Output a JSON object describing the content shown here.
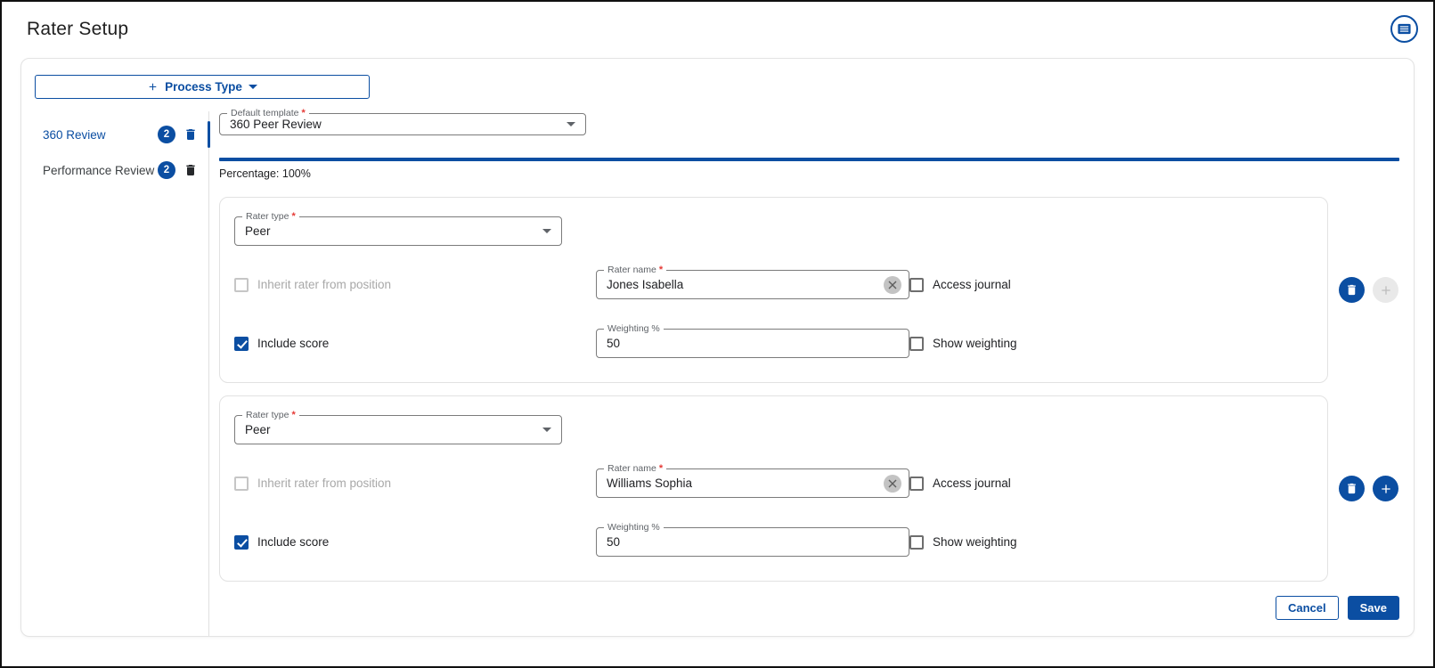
{
  "colors": {
    "primary": "#0b4ea2",
    "required_asterisk": "#e53935",
    "disabled_text": "#a8a8a8",
    "card_border": "#e2e2e2",
    "percentage_bar": "#0b4ea2"
  },
  "icons": {
    "header_menu": "list-circle-icon",
    "delete": "trash-icon",
    "add": "plus-icon",
    "clear": "clear-x-icon",
    "dropdown": "caret-down-icon",
    "plus_prefix": "plus-icon"
  },
  "header": {
    "title": "Rater Setup"
  },
  "panel": {
    "process_type_button": {
      "label": "Process Type"
    },
    "sidebar": {
      "items": [
        {
          "label": "360 Review",
          "count": "2",
          "selected": true
        },
        {
          "label": "Performance Review",
          "count": "2",
          "selected": false
        }
      ]
    },
    "main": {
      "default_template": {
        "label": "Default template",
        "required": "*",
        "value": "360 Peer Review"
      },
      "percentage_text": "Percentage: 100%",
      "percentage_value": "100%",
      "raters": [
        {
          "rater_type": {
            "label": "Rater type",
            "required": "*",
            "value": "Peer"
          },
          "inherit_checkbox": {
            "label": "Inherit rater from position",
            "checked": false,
            "disabled": true
          },
          "rater_name": {
            "label": "Rater name",
            "required": "*",
            "value": "Jones Isabella"
          },
          "access_journal": {
            "label": "Access journal",
            "checked": false
          },
          "include_score": {
            "label": "Include score",
            "checked": true
          },
          "weighting": {
            "label": "Weighting %",
            "value": "50"
          },
          "show_weighting": {
            "label": "Show weighting",
            "checked": false
          },
          "add_enabled": false
        },
        {
          "rater_type": {
            "label": "Rater type",
            "required": "*",
            "value": "Peer"
          },
          "inherit_checkbox": {
            "label": "Inherit rater from position",
            "checked": false,
            "disabled": true
          },
          "rater_name": {
            "label": "Rater name",
            "required": "*",
            "value": "Williams Sophia"
          },
          "access_journal": {
            "label": "Access journal",
            "checked": false
          },
          "include_score": {
            "label": "Include score",
            "checked": true
          },
          "weighting": {
            "label": "Weighting %",
            "value": "50"
          },
          "show_weighting": {
            "label": "Show weighting",
            "checked": false
          },
          "add_enabled": true
        }
      ],
      "footer": {
        "cancel_label": "Cancel",
        "save_label": "Save"
      }
    }
  }
}
